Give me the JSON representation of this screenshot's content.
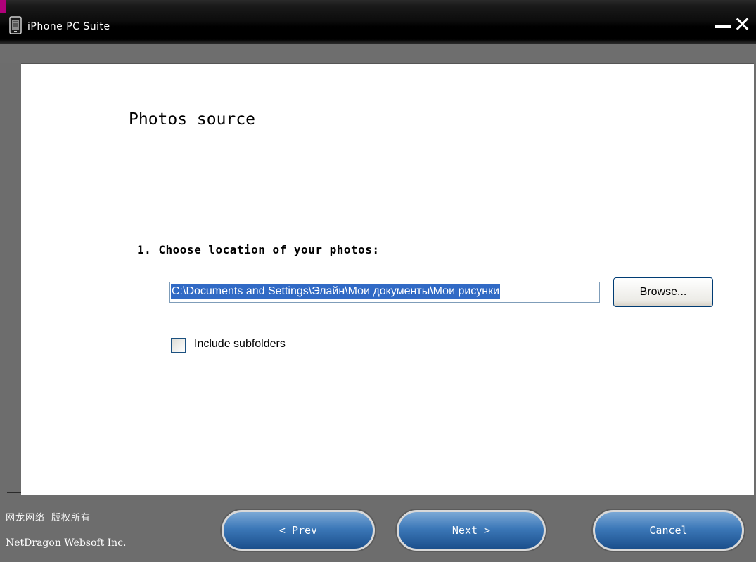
{
  "window": {
    "title": "iPhone PC Suite",
    "close_glyph": "✕",
    "icons": {
      "app": "phone-icon",
      "minimize": "minimize-icon",
      "close": "close-icon"
    }
  },
  "page": {
    "section_title": "Photos source",
    "step_label": "1. Choose location of your photos:",
    "path_value": "C:\\Documents and Settings\\Элайн\\Мои документы\\Мои рисунки",
    "browse_label": "Browse...",
    "include_subfolders_label": "Include subfolders",
    "include_subfolders_checked": false
  },
  "footer": {
    "chinese_text": "网龙网络  版权所有",
    "company": "NetDragon Websoft Inc.",
    "prev_label": "< Prev",
    "next_label": "Next >",
    "cancel_label": "Cancel"
  },
  "colors": {
    "frame": "#6d6d6d",
    "titlebar": "#000000",
    "selection": "#316ac5",
    "button_blue": "#3c78b8"
  }
}
